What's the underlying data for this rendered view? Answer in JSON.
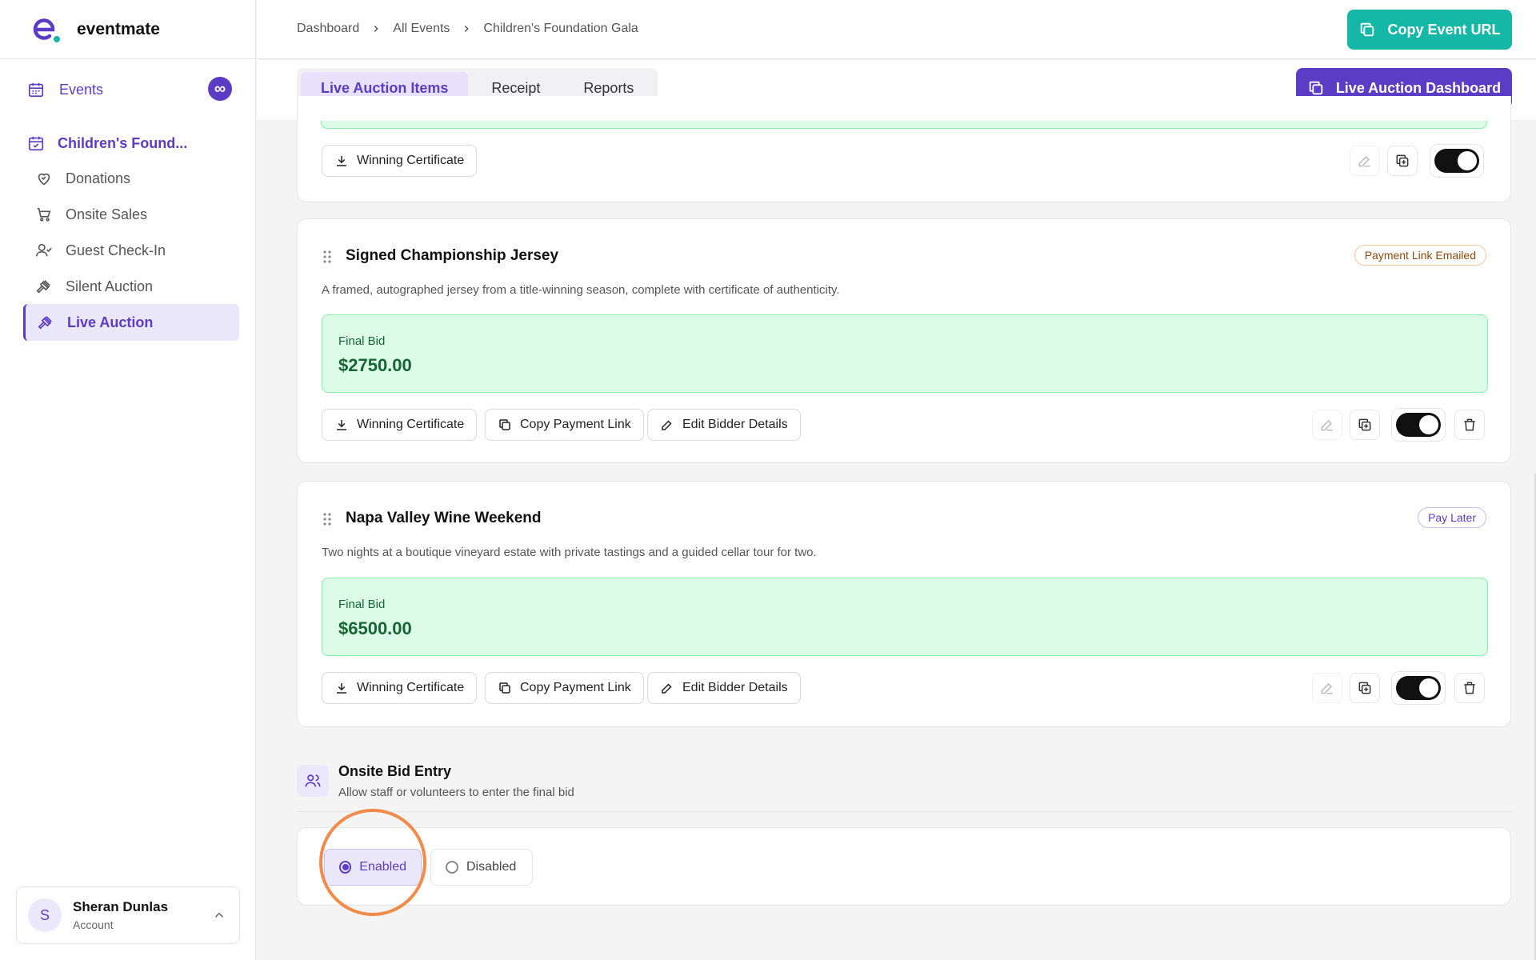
{
  "app": {
    "name": "eventmate",
    "logo_letter": "e"
  },
  "sidebar": {
    "events_label": "Events",
    "events_badge": "∞",
    "event_name": "Children's Found...",
    "items": [
      {
        "label": "Donations",
        "icon": "heart-icon"
      },
      {
        "label": "Onsite Sales",
        "icon": "cart-icon"
      },
      {
        "label": "Guest Check-In",
        "icon": "user-check-icon"
      },
      {
        "label": "Silent Auction",
        "icon": "gavel-icon"
      },
      {
        "label": "Live Auction",
        "icon": "gavel-icon",
        "active": true
      }
    ],
    "account": {
      "initial": "S",
      "name": "Sheran Dunlas",
      "role": "Account"
    }
  },
  "header": {
    "breadcrumb": [
      "Dashboard",
      "All Events",
      "Children's Foundation Gala"
    ],
    "copy_url_label": "Copy Event URL"
  },
  "tabs": {
    "items": [
      "Live Auction Items",
      "Receipt",
      "Reports"
    ],
    "active": "Live Auction Items",
    "dashboard_label": "Live Auction Dashboard"
  },
  "auction_items": [
    {
      "title": "",
      "actions": [
        "Winning Certificate"
      ]
    },
    {
      "title": "Signed Championship Jersey",
      "status": "Payment Link Emailed",
      "description": "A framed, autographed jersey from a title-winning season, complete with certificate of authenticity.",
      "final_bid_label": "Final Bid",
      "final_bid": "$2750.00",
      "actions": [
        "Winning Certificate",
        "Copy Payment Link",
        "Edit Bidder Details"
      ]
    },
    {
      "title": "Napa Valley Wine Weekend",
      "status": "Pay Later",
      "description": "Two nights at a boutique vineyard estate with private tastings and a guided cellar tour for two.",
      "final_bid_label": "Final Bid",
      "final_bid": "$6500.00",
      "actions": [
        "Winning Certificate",
        "Copy Payment Link",
        "Edit Bidder Details"
      ]
    }
  ],
  "onsite_bid_entry": {
    "title": "Onsite Bid Entry",
    "subtitle": "Allow staff or volunteers to enter the final bid",
    "options": [
      "Enabled",
      "Disabled"
    ],
    "selected": "Enabled"
  },
  "colors": {
    "brand": "#5b3cc4",
    "teal": "#15b8a6",
    "bid_green_bg": "#dcfce7",
    "bid_green_text": "#166534",
    "highlight": "#f28a4a"
  }
}
